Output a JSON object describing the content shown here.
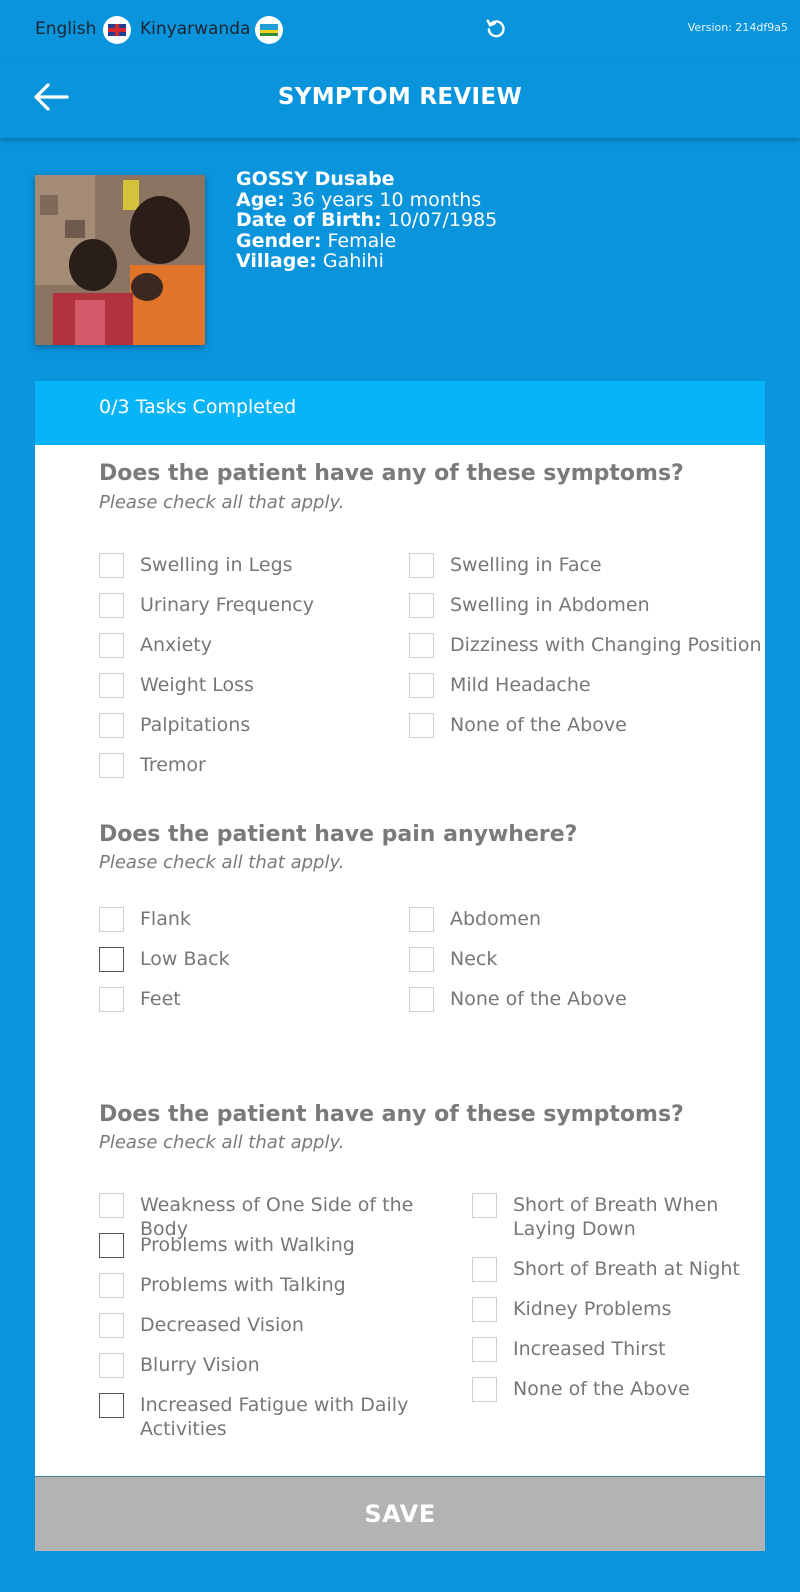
{
  "topbar": {
    "lang_en": "English",
    "lang_rw": "Kinyarwanda",
    "version": "Version: 214df9a5"
  },
  "header": {
    "title": "SYMPTOM REVIEW"
  },
  "patient": {
    "name": "GOSSY Dusabe",
    "age_label": "Age:",
    "age": "36 years 10 months",
    "dob_label": "Date of Birth:",
    "dob": "10/07/1985",
    "gender_label": "Gender:",
    "gender": "Female",
    "village_label": "Village:",
    "village": "Gahihi"
  },
  "progress": {
    "text": "0/3 Tasks Completed"
  },
  "sections": [
    {
      "title": "Does the patient have any of these symptoms?",
      "subtitle": "Please check all that apply.",
      "left": [
        "Swelling in Legs",
        "Urinary Frequency",
        "Anxiety",
        "Weight Loss",
        "Palpitations",
        "Tremor"
      ],
      "right": [
        "Swelling in Face",
        "Swelling in Abdomen",
        "Dizziness with Changing Position",
        "Mild Headache",
        "None of the Above"
      ]
    },
    {
      "title": "Does the patient have pain anywhere?",
      "subtitle": "Please check all that apply.",
      "left": [
        "Flank",
        "Low Back",
        "Feet"
      ],
      "right": [
        "Abdomen",
        "Neck",
        "None of the Above"
      ]
    },
    {
      "title": "Does the patient have any of these symptoms?",
      "subtitle": "Please check all that apply.",
      "left": [
        "Weakness of One Side of the Body",
        "Problems with Walking",
        "Problems with Talking",
        "Decreased Vision",
        "Blurry Vision",
        "Increased Fatigue with Daily Activities"
      ],
      "right": [
        "Short of Breath When Laying Down",
        "Short of Breath at Night",
        "Kidney Problems",
        "Increased Thirst",
        "None of the Above"
      ]
    }
  ],
  "save_label": "SAVE",
  "colors": {
    "background": "#0994dc",
    "progress_bar": "#07b4f7",
    "save_disabled": "#b3b3b3"
  }
}
